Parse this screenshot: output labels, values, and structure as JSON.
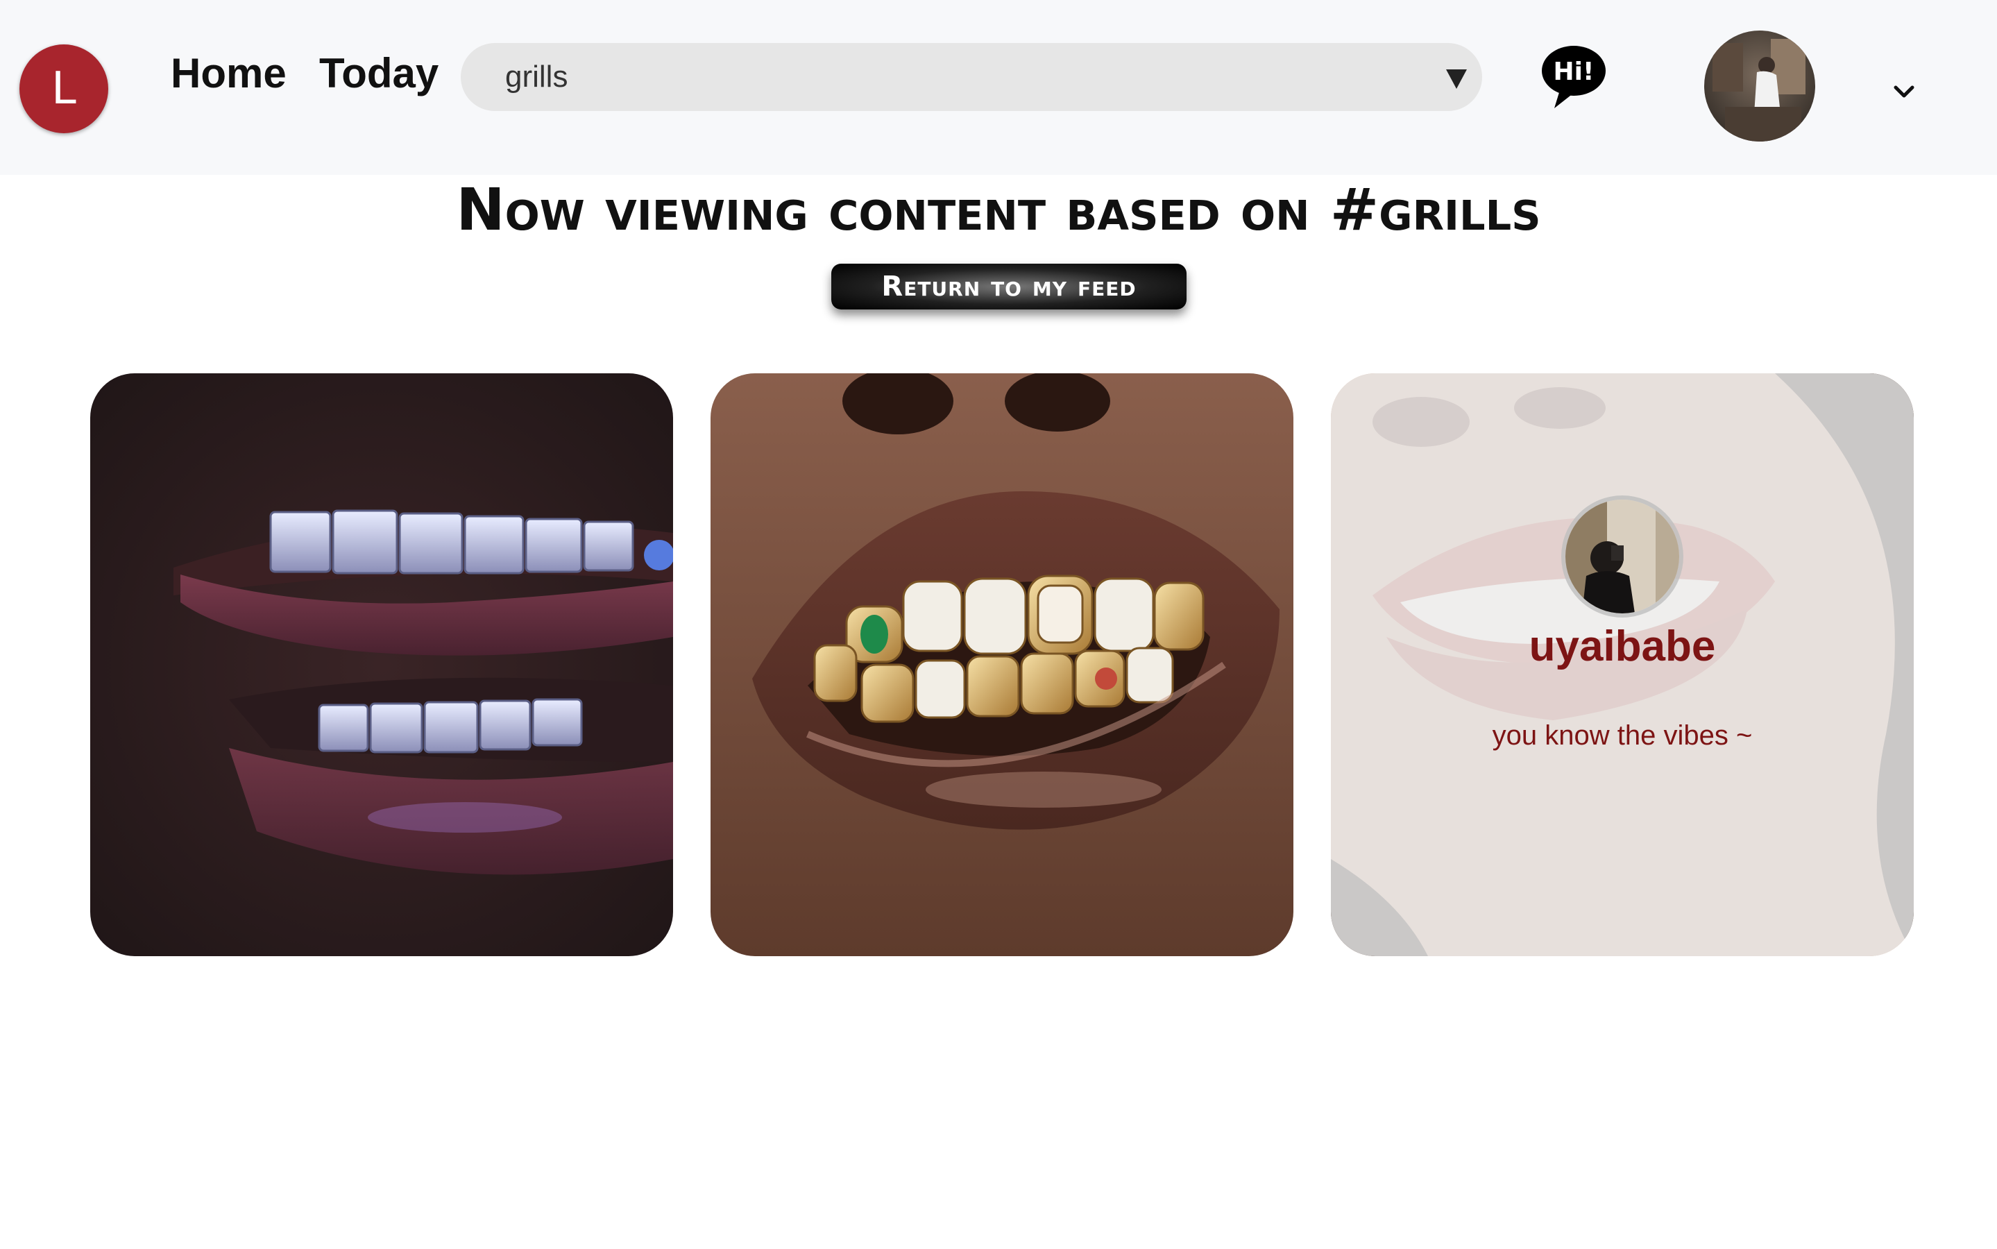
{
  "header": {
    "logo_letter": "L",
    "nav": {
      "home": "Home",
      "today": "Today"
    },
    "search": {
      "value": "grills"
    },
    "chat_icon_text": "Hi!"
  },
  "main": {
    "heading": "Now viewing content based on #grills",
    "return_button": "Return to my feed",
    "cards": [
      {
        "kind": "image",
        "description_icon": "grillz-photo-icon"
      },
      {
        "kind": "image",
        "description_icon": "gold-grillz-photo-icon"
      },
      {
        "kind": "profile",
        "username": "uyaibabe",
        "bio": "you know the vibes ~"
      }
    ]
  },
  "colors": {
    "brand_red": "#a8252d",
    "profile_text": "#7d1414",
    "topbar_bg": "#f7f8fa",
    "search_bg": "#e6e6e6"
  }
}
